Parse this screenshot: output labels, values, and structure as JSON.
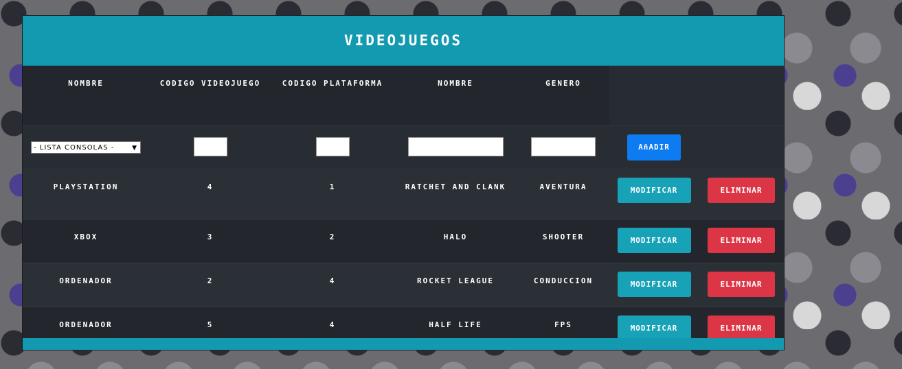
{
  "title": "VIDEOJUEGOS",
  "headers": [
    "NOMBRE",
    "CODIGO VIDEOJUEGO",
    "CODIGO PLATAFORMA",
    "NOMBRE",
    "GENERO"
  ],
  "form": {
    "select_value": "- LISTA CONSOLAS -",
    "add_label": "AñADIR"
  },
  "rows": [
    {
      "plataforma": "PLAYSTATION",
      "cod_videojuego": "4",
      "cod_plataforma": "1",
      "nombre": "RATCHET AND CLANK",
      "genero": "AVENTURA"
    },
    {
      "plataforma": "XBOX",
      "cod_videojuego": "3",
      "cod_plataforma": "2",
      "nombre": "HALO",
      "genero": "SHOOTER"
    },
    {
      "plataforma": "ORDENADOR",
      "cod_videojuego": "2",
      "cod_plataforma": "4",
      "nombre": "ROCKET LEAGUE",
      "genero": "CONDUCCION"
    },
    {
      "plataforma": "ORDENADOR",
      "cod_videojuego": "5",
      "cod_plataforma": "4",
      "nombre": "HALF LIFE",
      "genero": "FPS"
    }
  ],
  "actions": {
    "modify_label": "MODIFICAR",
    "delete_label": "ELIMINAR"
  },
  "colors": {
    "header": "#1399b0",
    "add": "#0d7bf2",
    "modify": "#17a2b8",
    "delete": "#dc3545"
  }
}
